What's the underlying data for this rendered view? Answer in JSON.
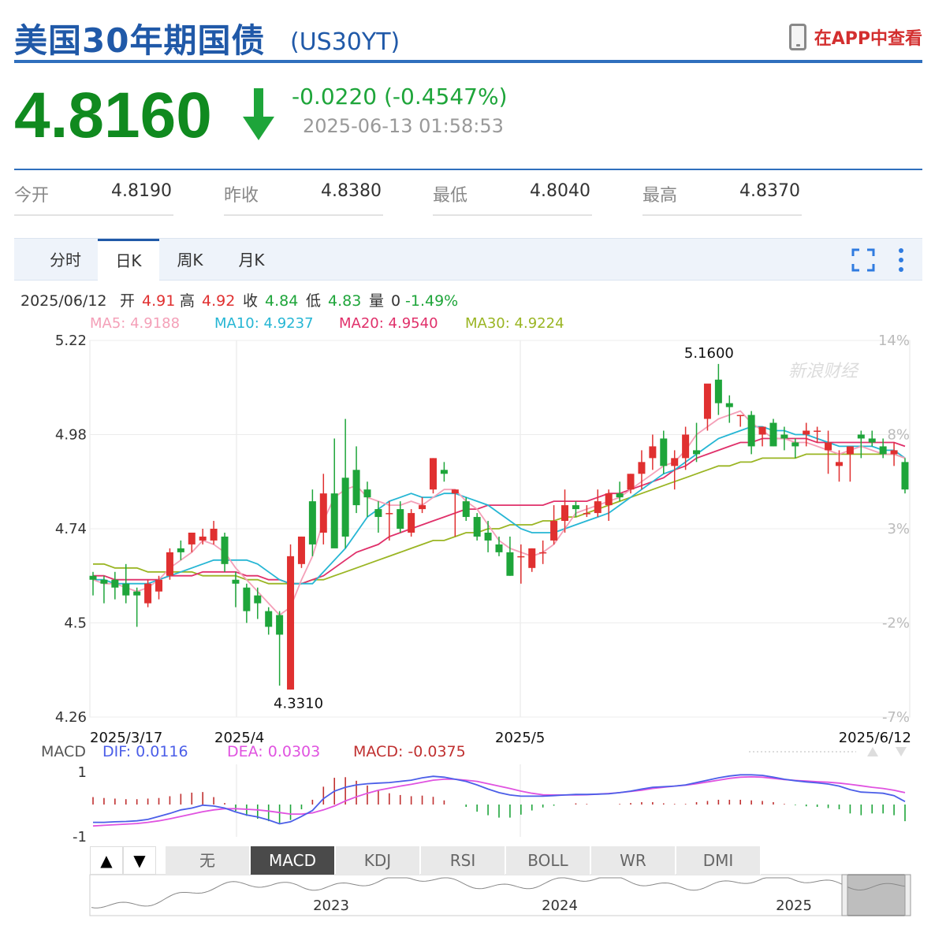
{
  "header": {
    "title": "美国30年期国债",
    "code": "(US30YT)",
    "app_link": "在APP中查看"
  },
  "quote": {
    "price": "4.8160",
    "change": "-0.0220 (-0.4547%)",
    "timestamp": "2025-06-13 01:58:53",
    "direction": "down"
  },
  "stats": [
    {
      "label": "今开",
      "value": "4.8190"
    },
    {
      "label": "昨收",
      "value": "4.8380"
    },
    {
      "label": "最低",
      "value": "4.8040"
    },
    {
      "label": "最高",
      "value": "4.8370"
    }
  ],
  "tabs": [
    "分时",
    "日K",
    "周K",
    "月K"
  ],
  "active_tab": "日K",
  "info_line": {
    "date": "2025/06/12",
    "open_label": "开",
    "open": "4.91",
    "high_label": "高",
    "high": "4.92",
    "close_label": "收",
    "close": "4.84",
    "low_label": "低",
    "low": "4.83",
    "vol_label": "量",
    "vol": "0",
    "pct": "-1.49%"
  },
  "ma_line": {
    "ma5": "MA5: 4.9188",
    "ma10": "MA10: 4.9237",
    "ma20": "MA20: 4.9540",
    "ma30": "MA30: 4.9224"
  },
  "watermark": "新浪财经",
  "macd_line": {
    "label": "MACD",
    "dif": "DIF: 0.0116",
    "dea": "DEA: 0.0303",
    "macd": "MACD: -0.0375"
  },
  "indicator_buttons": [
    "无",
    "MACD",
    "KDJ",
    "RSI",
    "BOLL",
    "WR",
    "DMI"
  ],
  "active_indicator": "MACD",
  "nav_buttons": [
    "▲",
    "▼"
  ],
  "overview_years": [
    "2023",
    "2024",
    "2025"
  ],
  "colors": {
    "up": "#e03030",
    "down": "#1ea53a",
    "ma5": "#f4a0b8",
    "ma10": "#26b6d4",
    "ma20": "#e0306a",
    "ma30": "#9ab523",
    "dif": "#4b5ee8",
    "dea": "#e053e0"
  },
  "chart_data": {
    "type": "candlestick",
    "title": "",
    "y_ticks_left": [
      "5.22",
      "4.98",
      "4.74",
      "4.5",
      "4.26"
    ],
    "y_ticks_right": [
      "14%",
      "8%",
      "3%",
      "-2%",
      "-7%"
    ],
    "ylim": [
      4.26,
      5.22
    ],
    "x_ticks": [
      "2025/3/17",
      "2025/4",
      "2025/5",
      "2025/6/12"
    ],
    "annotations": [
      {
        "text": "5.1600",
        "value": 5.16
      },
      {
        "text": "4.3310",
        "value": 4.331
      }
    ],
    "candles": [
      [
        4.62,
        4.63,
        4.57,
        4.61
      ],
      [
        4.61,
        4.62,
        4.55,
        4.6
      ],
      [
        4.61,
        4.63,
        4.56,
        4.59
      ],
      [
        4.6,
        4.65,
        4.55,
        4.57
      ],
      [
        4.58,
        4.59,
        4.49,
        4.57
      ],
      [
        4.55,
        4.61,
        4.54,
        4.6
      ],
      [
        4.58,
        4.62,
        4.56,
        4.61
      ],
      [
        4.62,
        4.69,
        4.61,
        4.68
      ],
      [
        4.69,
        4.71,
        4.66,
        4.68
      ],
      [
        4.7,
        4.73,
        4.68,
        4.73
      ],
      [
        4.71,
        4.74,
        4.7,
        4.72
      ],
      [
        4.71,
        4.76,
        4.7,
        4.74
      ],
      [
        4.72,
        4.73,
        4.63,
        4.65
      ],
      [
        4.61,
        4.63,
        4.54,
        4.6
      ],
      [
        4.59,
        4.6,
        4.5,
        4.53
      ],
      [
        4.57,
        4.59,
        4.51,
        4.55
      ],
      [
        4.53,
        4.54,
        4.47,
        4.49
      ],
      [
        4.52,
        4.53,
        4.34,
        4.47
      ],
      [
        4.33,
        4.7,
        4.33,
        4.67
      ],
      [
        4.65,
        4.72,
        4.64,
        4.72
      ],
      [
        4.81,
        4.84,
        4.67,
        4.7
      ],
      [
        4.73,
        4.88,
        4.7,
        4.83
      ],
      [
        4.83,
        4.97,
        4.8,
        4.69
      ],
      [
        4.87,
        5.02,
        4.69,
        4.72
      ],
      [
        4.89,
        4.95,
        4.78,
        4.8
      ],
      [
        4.84,
        4.86,
        4.77,
        4.82
      ],
      [
        4.79,
        4.81,
        4.73,
        4.77
      ],
      [
        4.78,
        4.81,
        4.71,
        4.78
      ],
      [
        4.79,
        4.81,
        4.73,
        4.74
      ],
      [
        4.73,
        4.79,
        4.72,
        4.78
      ],
      [
        4.79,
        4.82,
        4.78,
        4.8
      ],
      [
        4.84,
        4.92,
        4.83,
        4.92
      ],
      [
        4.89,
        4.91,
        4.86,
        4.88
      ],
      [
        4.83,
        4.84,
        4.72,
        4.84
      ],
      [
        4.81,
        4.82,
        4.76,
        4.77
      ],
      [
        4.77,
        4.78,
        4.71,
        4.72
      ],
      [
        4.73,
        4.76,
        4.68,
        4.71
      ],
      [
        4.7,
        4.72,
        4.67,
        4.68
      ],
      [
        4.68,
        4.72,
        4.62,
        4.62
      ],
      [
        4.67,
        4.7,
        4.6,
        4.67
      ],
      [
        4.64,
        4.69,
        4.63,
        4.69
      ],
      [
        4.68,
        4.71,
        4.65,
        4.68
      ],
      [
        4.71,
        4.8,
        4.7,
        4.76
      ],
      [
        4.76,
        4.84,
        4.73,
        4.8
      ],
      [
        4.8,
        4.81,
        4.77,
        4.79
      ],
      [
        4.78,
        4.8,
        4.77,
        4.78
      ],
      [
        4.78,
        4.84,
        4.77,
        4.81
      ],
      [
        4.8,
        4.84,
        4.76,
        4.83
      ],
      [
        4.83,
        4.86,
        4.81,
        4.82
      ],
      [
        4.84,
        4.88,
        4.83,
        4.88
      ],
      [
        4.88,
        4.94,
        4.84,
        4.91
      ],
      [
        4.92,
        4.98,
        4.89,
        4.95
      ],
      [
        4.97,
        4.99,
        4.88,
        4.9
      ],
      [
        4.9,
        4.94,
        4.84,
        4.92
      ],
      [
        4.92,
        5.0,
        4.89,
        4.98
      ],
      [
        4.94,
        5.01,
        4.91,
        4.93
      ],
      [
        5.02,
        5.09,
        4.99,
        5.11
      ],
      [
        5.12,
        5.16,
        5.03,
        5.06
      ],
      [
        5.06,
        5.08,
        5.01,
        5.05
      ],
      [
        5.03,
        5.03,
        5.0,
        5.03
      ],
      [
        5.03,
        5.04,
        4.93,
        4.95
      ],
      [
        4.98,
        5.0,
        4.95,
        5.0
      ],
      [
        5.01,
        5.02,
        4.95,
        4.95
      ],
      [
        4.98,
        5.0,
        4.94,
        4.97
      ],
      [
        4.96,
        4.97,
        4.92,
        4.95
      ],
      [
        4.98,
        5.01,
        4.95,
        4.99
      ],
      [
        4.99,
        5.0,
        4.96,
        4.99
      ],
      [
        4.94,
        4.99,
        4.88,
        4.96
      ],
      [
        4.9,
        4.94,
        4.86,
        4.91
      ],
      [
        4.93,
        4.95,
        4.86,
        4.95
      ],
      [
        4.98,
        4.99,
        4.92,
        4.97
      ],
      [
        4.97,
        4.99,
        4.95,
        4.96
      ],
      [
        4.95,
        4.97,
        4.92,
        4.93
      ],
      [
        4.93,
        4.96,
        4.9,
        4.94
      ],
      [
        4.91,
        4.92,
        4.83,
        4.84
      ]
    ],
    "ma5": [
      4.61,
      4.6,
      4.6,
      4.59,
      4.58,
      4.59,
      4.61,
      4.64,
      4.66,
      4.68,
      4.71,
      4.7,
      4.68,
      4.64,
      4.61,
      4.58,
      4.55,
      4.52,
      4.54,
      4.61,
      4.67,
      4.76,
      4.82,
      4.84,
      4.85,
      4.82,
      4.81,
      4.8,
      4.8,
      4.81,
      4.8,
      4.82,
      4.84,
      4.84,
      4.81,
      4.79,
      4.75,
      4.71,
      4.69,
      4.68,
      4.67,
      4.68,
      4.7,
      4.74,
      4.78,
      4.79,
      4.8,
      4.81,
      4.82,
      4.84,
      4.86,
      4.88,
      4.9,
      4.91,
      4.94,
      4.98,
      5.0,
      5.02,
      5.03,
      5.04,
      5.01,
      4.99,
      4.97,
      4.97,
      4.96,
      4.96,
      4.95,
      4.94,
      4.93,
      4.94,
      4.95,
      4.94,
      4.93,
      4.93,
      4.92
    ],
    "ma10": [
      4.61,
      4.61,
      4.6,
      4.6,
      4.6,
      4.6,
      4.61,
      4.62,
      4.63,
      4.64,
      4.65,
      4.66,
      4.66,
      4.66,
      4.66,
      4.65,
      4.63,
      4.61,
      4.6,
      4.6,
      4.6,
      4.63,
      4.66,
      4.69,
      4.73,
      4.77,
      4.79,
      4.81,
      4.82,
      4.83,
      4.82,
      4.82,
      4.83,
      4.83,
      4.82,
      4.81,
      4.8,
      4.78,
      4.76,
      4.74,
      4.73,
      4.73,
      4.73,
      4.74,
      4.75,
      4.76,
      4.77,
      4.78,
      4.8,
      4.82,
      4.84,
      4.86,
      4.88,
      4.89,
      4.91,
      4.93,
      4.95,
      4.97,
      4.98,
      4.99,
      5.0,
      5.0,
      4.99,
      4.99,
      4.98,
      4.98,
      4.97,
      4.96,
      4.95,
      4.95,
      4.95,
      4.95,
      4.94,
      4.94,
      4.92
    ],
    "ma20": [
      4.62,
      4.62,
      4.61,
      4.61,
      4.61,
      4.61,
      4.61,
      4.62,
      4.62,
      4.62,
      4.63,
      4.63,
      4.63,
      4.63,
      4.62,
      4.62,
      4.61,
      4.61,
      4.6,
      4.6,
      4.61,
      4.62,
      4.64,
      4.66,
      4.68,
      4.69,
      4.7,
      4.72,
      4.73,
      4.74,
      4.75,
      4.76,
      4.77,
      4.78,
      4.79,
      4.79,
      4.8,
      4.8,
      4.8,
      4.8,
      4.8,
      4.8,
      4.81,
      4.81,
      4.81,
      4.81,
      4.82,
      4.83,
      4.83,
      4.84,
      4.85,
      4.86,
      4.87,
      4.89,
      4.9,
      4.92,
      4.93,
      4.94,
      4.95,
      4.96,
      4.96,
      4.97,
      4.97,
      4.97,
      4.97,
      4.97,
      4.96,
      4.96,
      4.96,
      4.96,
      4.96,
      4.96,
      4.96,
      4.96,
      4.95
    ],
    "ma30": [
      4.65,
      4.65,
      4.64,
      4.64,
      4.64,
      4.63,
      4.63,
      4.63,
      4.63,
      4.63,
      4.62,
      4.62,
      4.62,
      4.62,
      4.61,
      4.61,
      4.6,
      4.6,
      4.6,
      4.6,
      4.61,
      4.61,
      4.62,
      4.63,
      4.64,
      4.65,
      4.66,
      4.67,
      4.68,
      4.69,
      4.7,
      4.71,
      4.71,
      4.72,
      4.73,
      4.73,
      4.74,
      4.74,
      4.75,
      4.75,
      4.75,
      4.76,
      4.76,
      4.77,
      4.77,
      4.78,
      4.79,
      4.8,
      4.81,
      4.82,
      4.83,
      4.84,
      4.85,
      4.86,
      4.87,
      4.88,
      4.89,
      4.9,
      4.9,
      4.91,
      4.91,
      4.92,
      4.92,
      4.92,
      4.92,
      4.93,
      4.93,
      4.93,
      4.93,
      4.93,
      4.93,
      4.93,
      4.93,
      4.93,
      4.92
    ],
    "macd_ylim": [
      -1,
      1
    ],
    "macd_ticks": [
      "1",
      "-1"
    ],
    "dif": [
      -0.6,
      -0.6,
      -0.58,
      -0.57,
      -0.55,
      -0.5,
      -0.4,
      -0.3,
      -0.18,
      -0.12,
      -0.02,
      -0.05,
      -0.12,
      -0.25,
      -0.35,
      -0.42,
      -0.52,
      -0.65,
      -0.58,
      -0.4,
      -0.2,
      0.2,
      0.45,
      0.58,
      0.66,
      0.7,
      0.72,
      0.74,
      0.78,
      0.82,
      0.9,
      0.95,
      0.92,
      0.85,
      0.78,
      0.66,
      0.52,
      0.4,
      0.32,
      0.28,
      0.28,
      0.28,
      0.3,
      0.32,
      0.34,
      0.34,
      0.35,
      0.36,
      0.4,
      0.45,
      0.52,
      0.58,
      0.6,
      0.62,
      0.66,
      0.74,
      0.82,
      0.9,
      0.96,
      1.0,
      1.0,
      0.98,
      0.92,
      0.85,
      0.8,
      0.76,
      0.73,
      0.69,
      0.62,
      0.5,
      0.42,
      0.4,
      0.38,
      0.3,
      0.1
    ],
    "dea": [
      -0.72,
      -0.7,
      -0.68,
      -0.66,
      -0.64,
      -0.6,
      -0.55,
      -0.48,
      -0.4,
      -0.32,
      -0.24,
      -0.18,
      -0.14,
      -0.14,
      -0.16,
      -0.18,
      -0.22,
      -0.27,
      -0.32,
      -0.32,
      -0.28,
      -0.18,
      -0.05,
      0.12,
      0.26,
      0.38,
      0.48,
      0.55,
      0.62,
      0.68,
      0.75,
      0.82,
      0.85,
      0.85,
      0.82,
      0.78,
      0.7,
      0.62,
      0.54,
      0.45,
      0.38,
      0.33,
      0.32,
      0.32,
      0.32,
      0.33,
      0.35,
      0.37,
      0.4,
      0.44,
      0.48,
      0.54,
      0.58,
      0.62,
      0.65,
      0.7,
      0.76,
      0.82,
      0.88,
      0.92,
      0.93,
      0.92,
      0.88,
      0.84,
      0.81,
      0.79,
      0.77,
      0.75,
      0.72,
      0.68,
      0.63,
      0.58,
      0.54,
      0.48,
      0.4
    ],
    "macd": [
      0.25,
      0.22,
      0.2,
      0.18,
      0.18,
      0.2,
      0.22,
      0.28,
      0.36,
      0.4,
      0.42,
      0.25,
      0.05,
      -0.22,
      -0.38,
      -0.48,
      -0.56,
      -0.62,
      -0.52,
      -0.16,
      0.16,
      0.6,
      0.9,
      0.92,
      0.8,
      0.64,
      0.48,
      0.38,
      0.32,
      0.28,
      0.3,
      0.26,
      0.14,
      0.0,
      -0.08,
      -0.24,
      -0.36,
      -0.44,
      -0.44,
      -0.34,
      -0.2,
      -0.1,
      -0.04,
      0.0,
      0.04,
      0.02,
      0.0,
      0.0,
      0.02,
      0.05,
      0.08,
      0.08,
      0.04,
      0.02,
      0.02,
      0.08,
      0.12,
      0.16,
      0.16,
      0.16,
      0.14,
      0.12,
      0.08,
      0.02,
      -0.02,
      -0.06,
      -0.08,
      -0.12,
      -0.16,
      -0.3,
      -0.36,
      -0.3,
      -0.3,
      -0.36,
      -0.56
    ]
  }
}
